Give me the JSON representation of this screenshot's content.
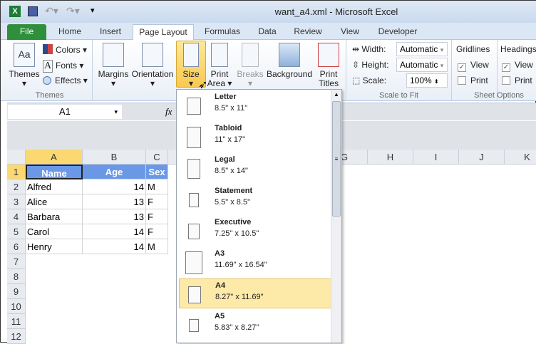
{
  "window": {
    "title": "want_a4.xml  -  Microsoft Excel"
  },
  "tabs": [
    "File",
    "Home",
    "Insert",
    "Page Layout",
    "Formulas",
    "Data",
    "Review",
    "View",
    "Developer"
  ],
  "ribbon": {
    "themes": {
      "themes": "Themes",
      "colors": "Colors",
      "fonts": "Fonts",
      "effects": "Effects",
      "label": "Themes"
    },
    "page_setup": {
      "margins": "Margins",
      "orientation": "Orientation",
      "size": "Size",
      "print": "Print",
      "area": "Area",
      "breaks": "Breaks",
      "background": "Background",
      "print2": "Print",
      "titles": "Titles"
    },
    "scale": {
      "width_label": "Width:",
      "width_value": "Automatic",
      "height_label": "Height:",
      "height_value": "Automatic",
      "scale_label": "Scale:",
      "scale_value": "100%",
      "label": "Scale to Fit"
    },
    "sheet": {
      "gridlines": "Gridlines",
      "headings": "Headings",
      "view": "View",
      "print": "Print",
      "label": "Sheet Options"
    }
  },
  "namebox": "A1",
  "fx": "fx",
  "columns": [
    "A",
    "B",
    "C",
    "G",
    "H",
    "I",
    "J",
    "K"
  ],
  "rows": [
    "1",
    "2",
    "3",
    "4",
    "5",
    "6",
    "7",
    "8",
    "9",
    "10",
    "11",
    "12"
  ],
  "table": {
    "header": [
      "Name",
      "Age",
      "Sex"
    ],
    "data": [
      [
        "Alfred",
        "14",
        "M"
      ],
      [
        "Alice",
        "13",
        "F"
      ],
      [
        "Barbara",
        "13",
        "F"
      ],
      [
        "Carol",
        "14",
        "F"
      ],
      [
        "Henry",
        "14",
        "M"
      ]
    ]
  },
  "size_menu": [
    {
      "name": "Letter",
      "dims": "8.5\" x 11\""
    },
    {
      "name": "Tabloid",
      "dims": "11\" x 17\""
    },
    {
      "name": "Legal",
      "dims": "8.5\" x 14\""
    },
    {
      "name": "Statement",
      "dims": "5.5\" x 8.5\""
    },
    {
      "name": "Executive",
      "dims": "7.25\" x 10.5\""
    },
    {
      "name": "A3",
      "dims": "11.69\" x 16.54\""
    },
    {
      "name": "A4",
      "dims": "8.27\" x 11.69\"",
      "selected": true
    },
    {
      "name": "A5",
      "dims": "5.83\" x 8.27\""
    }
  ]
}
